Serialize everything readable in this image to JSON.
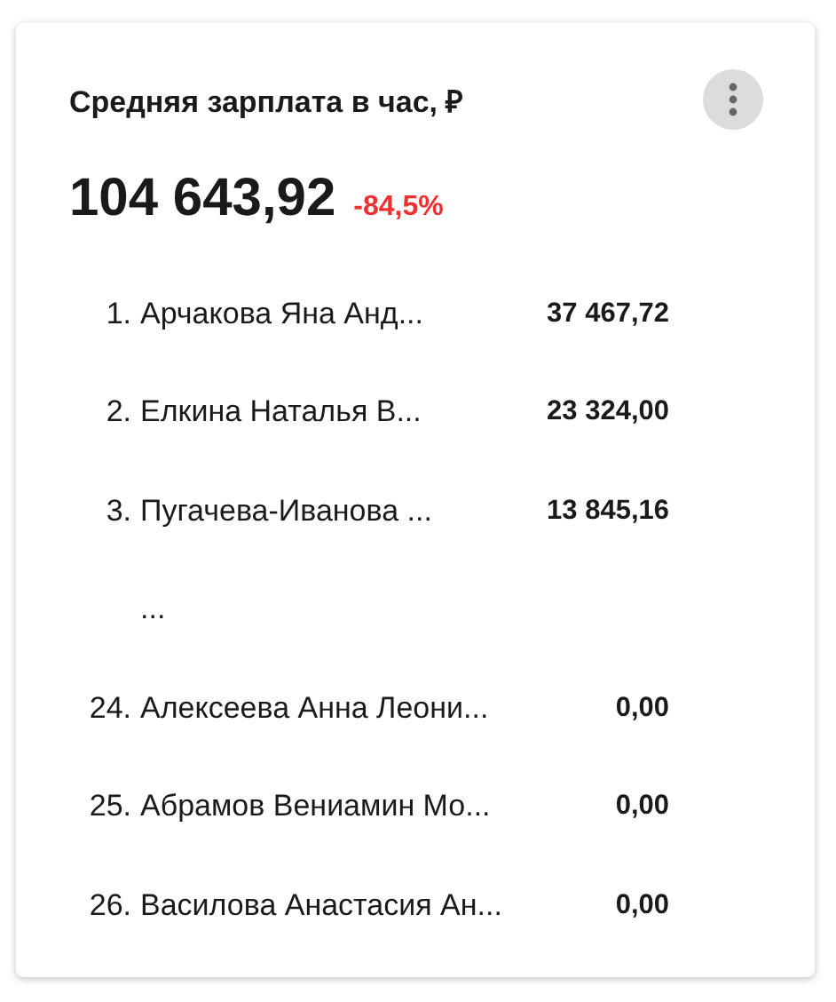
{
  "card": {
    "title": "Средняя зарплата в час, ₽",
    "total": "104 643,92",
    "change": "-84,5%",
    "rows": [
      {
        "kind": "entry",
        "rank": "1.",
        "name": "Арчакова Яна Анд...",
        "value": "37 467,72"
      },
      {
        "kind": "entry",
        "rank": "2.",
        "name": "Елкина Наталья В...",
        "value": "23 324,00"
      },
      {
        "kind": "entry",
        "rank": "3.",
        "name": "Пугачева-Иванова ...",
        "value": "13 845,16"
      },
      {
        "kind": "gap",
        "text": "..."
      },
      {
        "kind": "entry",
        "rank": "24.",
        "name": "Алексеева Анна Леони...",
        "value": "0,00"
      },
      {
        "kind": "entry",
        "rank": "25.",
        "name": "Абрамов Вениамин Мо...",
        "value": "0,00"
      },
      {
        "kind": "entry",
        "rank": "26.",
        "name": "Василова Анастасия Ан...",
        "value": "0,00"
      }
    ]
  }
}
